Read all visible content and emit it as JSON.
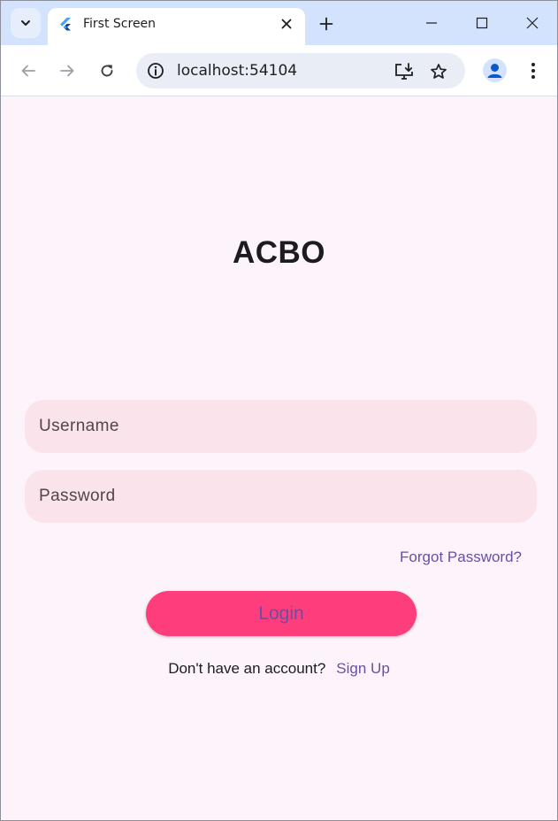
{
  "browser": {
    "tab": {
      "title": "First Screen"
    },
    "address_bar": {
      "url": "localhost:54104"
    }
  },
  "page": {
    "app_title": "ACBO",
    "username": {
      "placeholder": "Username",
      "value": ""
    },
    "password": {
      "placeholder": "Password",
      "value": ""
    },
    "forgot_password_label": "Forgot Password?",
    "login_label": "Login",
    "no_account_text": "Don't have an account?",
    "sign_up_label": "Sign Up"
  },
  "icons": {
    "tab_search": "chevron-down-icon",
    "favicon": "flutter-icon",
    "tab_close": "close-icon",
    "new_tab": "plus-icon",
    "minimize": "minimize-icon",
    "maximize": "maximize-icon",
    "window_close": "close-icon",
    "back": "arrow-left-icon",
    "forward": "arrow-right-icon",
    "reload": "reload-icon",
    "site_info": "info-icon",
    "install_app": "install-icon",
    "bookmark": "star-icon",
    "profile": "avatar-icon",
    "menu": "kebab-menu-icon"
  },
  "colors": {
    "page_background": "#fdf3fb",
    "field_background": "#fae3ea",
    "login_button": "#fe3e7c",
    "link": "#6750a4",
    "tabstrip": "#d3e3fd"
  }
}
